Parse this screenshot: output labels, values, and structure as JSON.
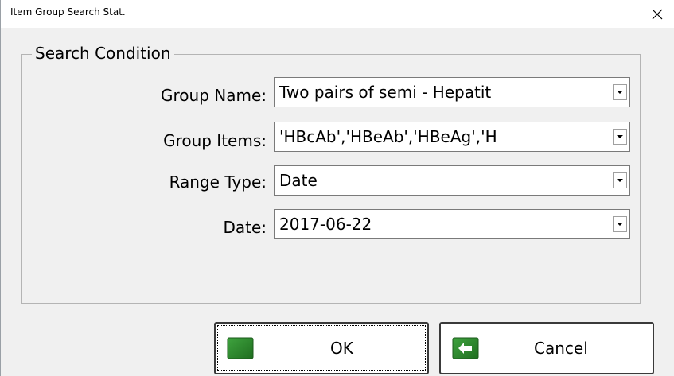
{
  "window": {
    "title": "Item Group Search Stat.",
    "close_icon": "close-icon"
  },
  "search_condition": {
    "legend": "Search Condition",
    "group_name": {
      "label": "Group Name:",
      "value": "Two pairs of semi - Hepatit"
    },
    "group_items": {
      "label": "Group Items:",
      "value": "'HBcAb','HBeAb','HBeAg','H"
    },
    "range_type": {
      "label": "Range Type:",
      "value": "Date"
    },
    "date": {
      "label": "Date:",
      "value": "2017-06-22"
    }
  },
  "buttons": {
    "ok_label": "OK",
    "ok_icon": "green-square-icon",
    "cancel_label": "Cancel",
    "cancel_icon": "left-arrow-icon"
  },
  "colors": {
    "ok_icon": "#2e8b2e",
    "cancel_icon": "#2e8b2e",
    "dialog_bg": "#f0f0f0"
  }
}
